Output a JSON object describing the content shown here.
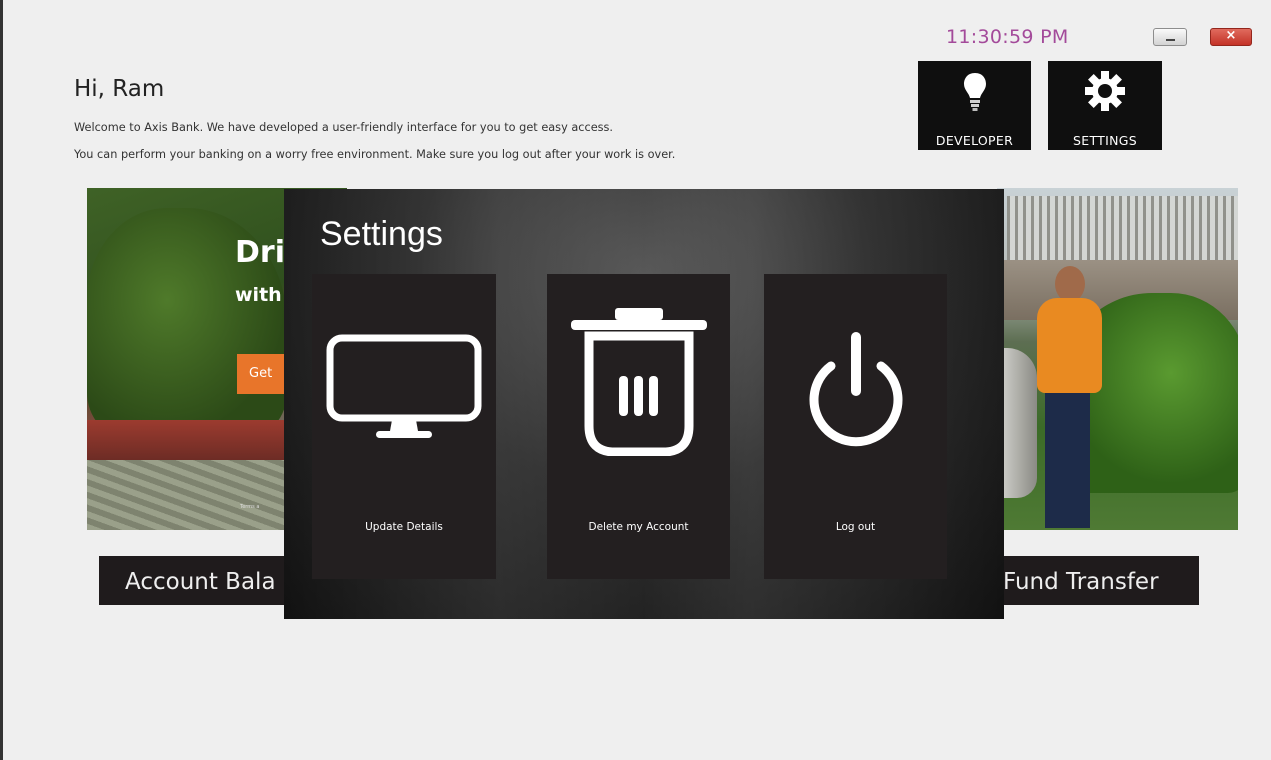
{
  "window": {
    "clock": "11:30:59 PM",
    "minimize_icon": "minimize-icon",
    "close_label": "×"
  },
  "header": {
    "greeting": "Hi, Ram",
    "welcome_line_1": "Welcome to Axis Bank. We have developed a user-friendly interface for you to get easy access.",
    "welcome_line_2": "You can perform your banking on a worry free environment. Make sure you log out after your work is over."
  },
  "tiles": {
    "developer": {
      "label": "DEVELOPER",
      "icon": "lightbulb-icon"
    },
    "settings": {
      "label": "SETTINGS",
      "icon": "gear-icon"
    }
  },
  "banner": {
    "heading": "Dri",
    "subheading": "with",
    "button": "Get",
    "terms": "Terms a"
  },
  "strips": {
    "account_balance": "Account Bala",
    "fund_transfer": "Fund Transfer"
  },
  "settings_modal": {
    "title": "Settings",
    "options": [
      {
        "label": "Update Details",
        "icon": "monitor-icon"
      },
      {
        "label": "Delete my Account",
        "icon": "trash-icon"
      },
      {
        "label": "Log out",
        "icon": "power-icon"
      }
    ]
  },
  "colors": {
    "clock": "#a34a9a",
    "tile_bg": "#0f0f0f",
    "modal_option_bg": "#231f20",
    "banner_button": "#e8752a",
    "close_button": "#c33227"
  }
}
